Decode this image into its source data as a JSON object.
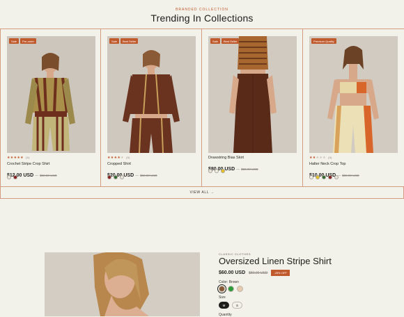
{
  "section": {
    "eyebrow": "BRANDED COLLECTION",
    "title": "Trending In Collections",
    "view_all": "VIEW ALL →"
  },
  "products": [
    {
      "badges": [
        "Sale",
        "Pre-order"
      ],
      "rating_text": "★★★★★",
      "rating": 5,
      "reviews": "(5)",
      "name": "Crochet Stripe Crop Shirt",
      "price": "$12.00 USD",
      "compare": "$80.00 USD",
      "swatches": [
        "#e8e4da",
        "#8b1f1f"
      ]
    },
    {
      "badges": [
        "Sale",
        "Best Seller"
      ],
      "rating_text": "★★★★★",
      "rating": 4,
      "reviews": "(5)",
      "name": "Cropped Shirt",
      "price": "$20.00 USD",
      "compare": "$80.00 USD",
      "swatches": [
        "#8b1f1f",
        "#2e6b2e",
        "#e8e4da"
      ]
    },
    {
      "badges": [
        "Sale",
        "Best Seller"
      ],
      "rating_text": "",
      "rating": 0,
      "reviews": "",
      "name": "Drawstring Bias Skirt",
      "price": "$80.00 USD",
      "compare": "$80.00 USD",
      "swatches": [
        "#e8e4da",
        "#f0ede4",
        "#e8c21d"
      ]
    },
    {
      "badges": [
        "Premium Quality"
      ],
      "rating_text": "★★★★★",
      "rating": 2,
      "reviews": "(5)",
      "name": "Halter Neck Crop Top",
      "price": "$10.00 USD",
      "compare": "$80.00 USD",
      "swatches": [
        "#f0ede4",
        "#e8c21d",
        "#2e6b2e",
        "#8b1f1f",
        "#e8e4da"
      ]
    }
  ],
  "featured": {
    "category": "CLASSIC CLOTHES",
    "title": "Oversized Linen Stripe Shirt",
    "price": "$60.00 USD",
    "compare": "$80.00 USD",
    "discount": "-25% OFF",
    "color_label": "Color: Brown",
    "colors": [
      "#8a5a36",
      "#2f9a3a",
      "#e7c9ad"
    ],
    "size_label": "Size",
    "sizes": [
      "M",
      "S"
    ],
    "quantity_label": "Quantity"
  },
  "colors": {
    "accent": "#c0592c",
    "background": "#f2f1ea"
  }
}
